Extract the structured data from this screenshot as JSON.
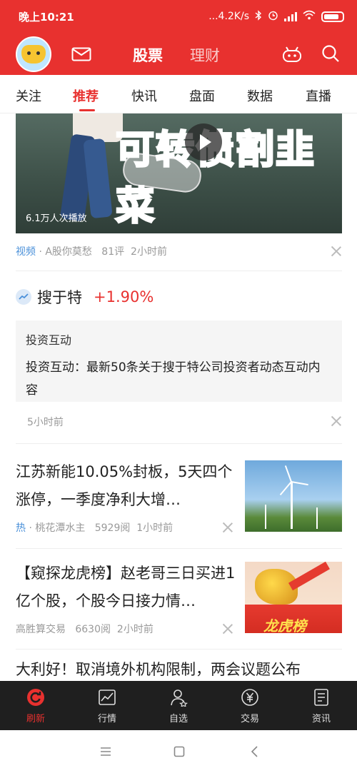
{
  "status_bar": {
    "time": "晚上10:21",
    "net_speed": "...4.2K/s",
    "icons": [
      "bluetooth-icon",
      "alarm-icon",
      "signal-icon",
      "wifi-icon",
      "battery-icon"
    ]
  },
  "header": {
    "tabs": [
      {
        "label": "股票",
        "active": true
      },
      {
        "label": "理财",
        "active": false
      }
    ],
    "icons": [
      "avatar",
      "mail-icon",
      "robot-icon",
      "search-icon"
    ],
    "colors": {
      "brand_red": "#e8312f"
    }
  },
  "categories": [
    {
      "label": "关注"
    },
    {
      "label": "推荐",
      "active": true
    },
    {
      "label": "快讯"
    },
    {
      "label": "盘面"
    },
    {
      "label": "数据"
    },
    {
      "label": "直播"
    }
  ],
  "video_card": {
    "overlay_title": "可转债割韭菜",
    "views": "6.1万人次播放",
    "tag": "视频",
    "source": "A股你莫愁",
    "comments": "81评",
    "time": "2小时前"
  },
  "stock_card": {
    "name": "搜于特",
    "change": "+1.90%",
    "box_title": "投资互动",
    "box_text": "投资互动：最新50条关于搜于特公司投资者动态互动内容",
    "time": "5小时前"
  },
  "news": [
    {
      "title": "江苏新能10.05%封板，5天四个涨停，一季度净利大增…",
      "tag": "热",
      "source": "桃花潭水主",
      "reads": "5929阅",
      "time": "1小时前",
      "thumb": "wind-turbine-image"
    },
    {
      "title": "【窥探龙虎榜】赵老哥三日买进1亿个股，个股今日接力情…",
      "source": "高胜算交易",
      "reads": "6630阅",
      "time": "2小时前",
      "thumb": "bull-image",
      "thumb_text": "龙虎榜"
    },
    {
      "title": "大利好！取消境外机构限制，两会议题公布"
    }
  ],
  "bottom_nav": [
    {
      "label": "刷新",
      "icon": "refresh-icon",
      "active": true
    },
    {
      "label": "行情",
      "icon": "chart-icon"
    },
    {
      "label": "自选",
      "icon": "user-star-icon"
    },
    {
      "label": "交易",
      "icon": "yuan-icon"
    },
    {
      "label": "资讯",
      "icon": "document-icon"
    }
  ],
  "system_nav": [
    "menu-icon",
    "home-icon",
    "back-icon"
  ]
}
